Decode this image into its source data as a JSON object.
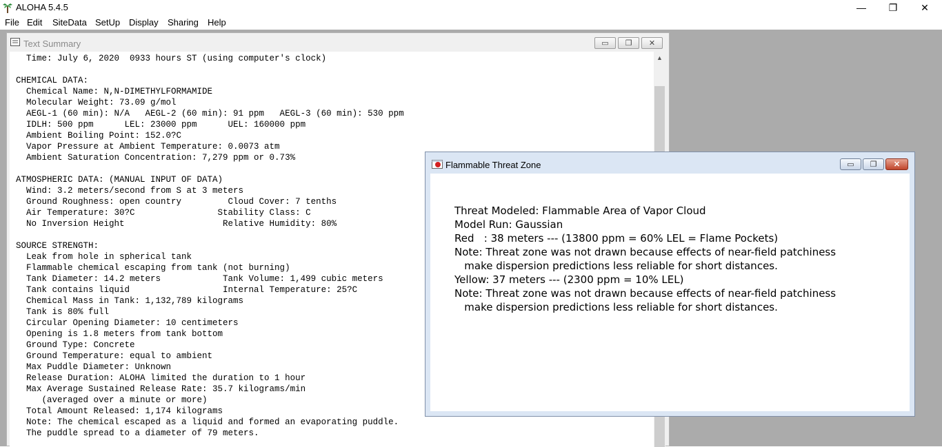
{
  "app": {
    "title": "ALOHA 5.4.5",
    "window_controls": {
      "minimize": "—",
      "maximize": "❐",
      "close": "✕"
    }
  },
  "menu": [
    "File",
    "Edit",
    "SiteData",
    "SetUp",
    "Display",
    "Sharing",
    "Help"
  ],
  "text_summary": {
    "title": "Text Summary",
    "lines": [
      "  Time: July 6, 2020  0933 hours ST (using computer's clock)",
      "",
      "CHEMICAL DATA:",
      "  Chemical Name: N,N-DIMETHYLFORMAMIDE",
      "  Molecular Weight: 73.09 g/mol",
      "  AEGL-1 (60 min): N/A   AEGL-2 (60 min): 91 ppm   AEGL-3 (60 min): 530 ppm",
      "  IDLH: 500 ppm      LEL: 23000 ppm      UEL: 160000 ppm",
      "  Ambient Boiling Point: 152.0?C",
      "  Vapor Pressure at Ambient Temperature: 0.0073 atm",
      "  Ambient Saturation Concentration: 7,279 ppm or 0.73%",
      "",
      "ATMOSPHERIC DATA: (MANUAL INPUT OF DATA)",
      "  Wind: 3.2 meters/second from S at 3 meters",
      "  Ground Roughness: open country         Cloud Cover: 7 tenths",
      "  Air Temperature: 30?C                Stability Class: C",
      "  No Inversion Height                   Relative Humidity: 80%",
      "",
      "SOURCE STRENGTH:",
      "  Leak from hole in spherical tank",
      "  Flammable chemical escaping from tank (not burning)",
      "  Tank Diameter: 14.2 meters            Tank Volume: 1,499 cubic meters",
      "  Tank contains liquid                  Internal Temperature: 25?C",
      "  Chemical Mass in Tank: 1,132,789 kilograms",
      "  Tank is 80% full",
      "  Circular Opening Diameter: 10 centimeters",
      "  Opening is 1.8 meters from tank bottom",
      "  Ground Type: Concrete",
      "  Ground Temperature: equal to ambient",
      "  Max Puddle Diameter: Unknown",
      "  Release Duration: ALOHA limited the duration to 1 hour",
      "  Max Average Sustained Release Rate: 35.7 kilograms/min",
      "     (averaged over a minute or more)",
      "  Total Amount Released: 1,174 kilograms",
      "  Note: The chemical escaped as a liquid and formed an evaporating puddle.",
      "  The puddle spread to a diameter of 79 meters."
    ]
  },
  "threat_zone": {
    "title": "Flammable Threat Zone",
    "lines": [
      "Threat Modeled: Flammable Area of Vapor Cloud",
      "Model Run: Gaussian",
      "Red   : 38 meters --- (13800 ppm = 60% LEL = Flame Pockets)",
      "Note: Threat zone was not drawn because effects of near-field patchiness",
      "   make dispersion predictions less reliable for short distances.",
      "Yellow: 37 meters --- (2300 ppm = 10% LEL)",
      "Note: Threat zone was not drawn because effects of near-field patchiness",
      "   make dispersion predictions less reliable for short distances."
    ]
  },
  "icons": {
    "app": "palm-tree-icon",
    "text_summary": "text-document-icon",
    "threat_zone": "flame-window-icon"
  },
  "colors": {
    "mdi_background": "#ababab",
    "threat_window_frame": "#dbe6f4",
    "close_button_red": "#c0452c"
  }
}
